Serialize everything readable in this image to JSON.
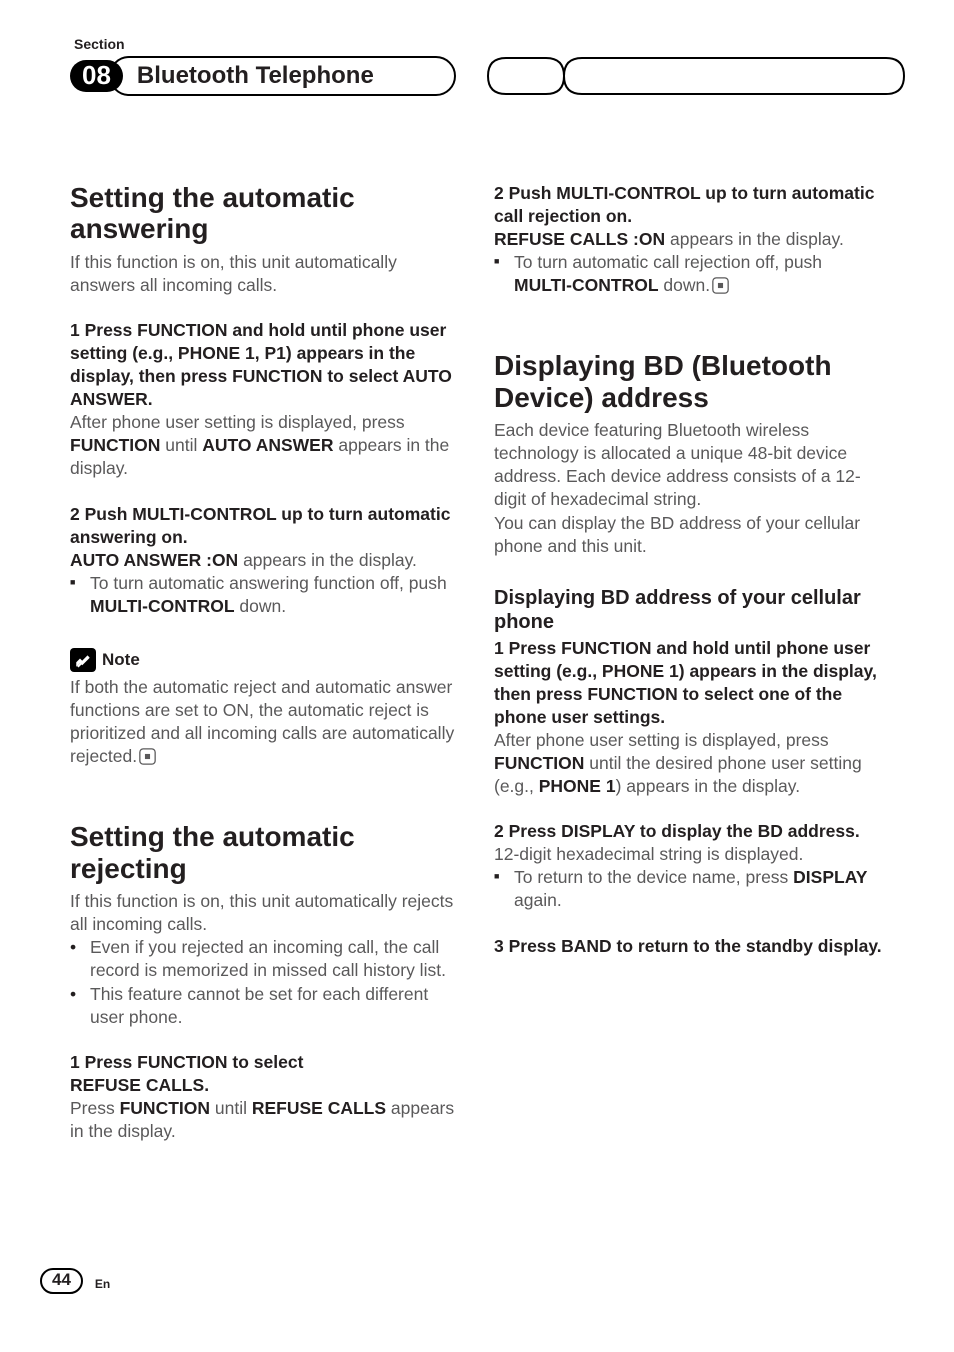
{
  "header": {
    "section_label": "Section",
    "section_number": "08",
    "chapter_title": "Bluetooth Telephone"
  },
  "footer": {
    "page_number": "44",
    "language": "En"
  },
  "col1": {
    "h1a": "Setting the automatic answering",
    "p1": "If this function is on, this unit automatically answers all incoming calls.",
    "s1_lead": "1    Press FUNCTION and hold until phone user setting (e.g., PHONE 1, P1) appears in the display, then press FUNCTION to select AUTO ANSWER.",
    "s1_a1": "After phone user setting is displayed, press ",
    "s1_a2": "FUNCTION",
    "s1_a3": " until ",
    "s1_a4": "AUTO ANSWER",
    "s1_a5": " appears in the display.",
    "s2_lead": "2    Push MULTI-CONTROL up to turn automatic answering on.",
    "s2_a1": "AUTO ANSWER",
    "s2_a1b": " :ON",
    "s2_a2": " appears in the display.",
    "s2_b1": "To turn automatic answering function off, push ",
    "s2_b2": "MULTI-CONTROL",
    "s2_b3": " down.",
    "note_label": "Note",
    "note_body": "If both the automatic reject and automatic answer functions are set to ON, the automatic reject is prioritized and all incoming calls are automatically rejected.",
    "h1b": "Setting the automatic rejecting",
    "p2": "If this function is on, this unit automatically rejects all incoming calls.",
    "li1": "Even if you rejected an incoming call, the call record is memorized in missed call history list.",
    "li2": "This feature cannot be set for each different user phone.",
    "s3_lead_a": "1    Press FUNCTION to select",
    "s3_lead_b": "REFUSE CALLS",
    "s3_a1": "Press ",
    "s3_a2": "FUNCTION",
    "s3_a3": " until ",
    "s3_a4": "REFUSE CALLS",
    "s3_a5": " appears in the display."
  },
  "col2": {
    "s1_lead": "2    Push MULTI-CONTROL up to turn automatic call rejection on.",
    "s1_a1": "REFUSE CALLS",
    "s1_a1b": " :ON",
    "s1_a2": " appears in the display.",
    "s1_b1": "To turn automatic call rejection off, push ",
    "s1_b2": "MULTI-CONTROL",
    "s1_b3": " down.",
    "h1a": "Displaying BD (Bluetooth Device) address",
    "p1": "Each device featuring Bluetooth wireless technology is allocated a unique 48-bit device address. Each device address consists of a 12-digit of hexadecimal string.",
    "p1b": "You can display the BD address of your cellular phone and this unit.",
    "h2a": "Displaying BD address of your cellular phone",
    "s2_lead": "1    Press FUNCTION and hold until phone user setting (e.g., PHONE 1) appears in the display, then press FUNCTION to select one of the phone user settings.",
    "s2_a1": "After phone user setting is displayed, press ",
    "s2_a2": "FUNCTION",
    "s2_a3": " until the desired phone user setting (e.g., ",
    "s2_a4": "PHONE 1",
    "s2_a5": ") appears in the display.",
    "s3_lead": "2    Press DISPLAY to display the BD address.",
    "s3_a": "12-digit hexadecimal string is displayed.",
    "s3_b1": "To return to the device name, press ",
    "s3_b2": "DISPLAY",
    "s3_b3": " again.",
    "s4_lead": "3    Press BAND to return to the standby display."
  }
}
